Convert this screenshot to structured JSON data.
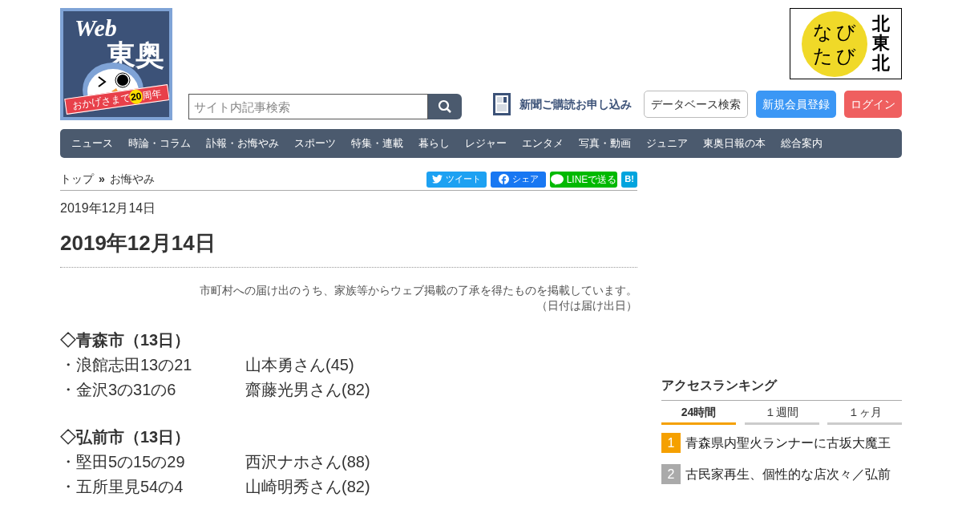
{
  "header": {
    "logo": {
      "web": "Web",
      "name": "東奥",
      "ribbon_text": "おかげさまで",
      "ribbon_number": "20",
      "ribbon_suffix": "周年"
    },
    "search": {
      "placeholder": "サイト内記事検索"
    },
    "subscribe_link": "新聞ご購読お申し込み",
    "buttons": [
      {
        "label": "データベース検索",
        "kind": "outline"
      },
      {
        "label": "新規会員登録",
        "kind": "primary"
      },
      {
        "label": "ログイン",
        "kind": "danger"
      }
    ],
    "partner_logo": {
      "lines": [
        "なび",
        "たび"
      ],
      "vertical": "北東北"
    }
  },
  "nav": [
    "ニュース",
    "時論・コラム",
    "訃報・お悔やみ",
    "スポーツ",
    "特集・連載",
    "暮らし",
    "レジャー",
    "エンタメ",
    "写真・動画",
    "ジュニア",
    "東奥日報の本",
    "総合案内"
  ],
  "breadcrumb": [
    "トップ",
    "お悔やみ"
  ],
  "breadcrumb_separator": "»",
  "share_buttons": [
    {
      "label": "ツイート",
      "kind": "twitter"
    },
    {
      "label": "シェア",
      "kind": "facebook"
    },
    {
      "label": "LINEで送る",
      "kind": "line"
    },
    {
      "label": "B!",
      "kind": "hatena"
    }
  ],
  "article": {
    "date": "2019年12月14日",
    "title": "2019年12月14日",
    "note": [
      "市町村への届け出のうち、家族等からウェブ掲載の了承を得たものを掲載しています。",
      "（日付は届け出日）"
    ],
    "sections": [
      {
        "heading": "◇青森市（13日）",
        "entries": [
          {
            "address": "・浪館志田13の21",
            "name": "山本勇さん(45)"
          },
          {
            "address": "・金沢3の31の6",
            "name": "齋藤光男さん(82)"
          }
        ]
      },
      {
        "heading": "◇弘前市（13日）",
        "entries": [
          {
            "address": "・堅田5の15の29",
            "name": "西沢ナホさん(88)"
          },
          {
            "address": "・五所里見54の4",
            "name": "山崎明秀さん(82)"
          }
        ]
      }
    ]
  },
  "ranking": {
    "title": "アクセスランキング",
    "tabs": [
      {
        "label": "24時間",
        "selected": true
      },
      {
        "label": "１週間",
        "selected": false
      },
      {
        "label": "１ヶ月",
        "selected": false
      }
    ],
    "items": [
      {
        "rank": "1",
        "title": "青森県内聖火ランナーに古坂大魔王",
        "highlighted": true
      },
      {
        "rank": "2",
        "title": "古民家再生、個性的な店次々／弘前",
        "highlighted": false
      }
    ]
  }
}
